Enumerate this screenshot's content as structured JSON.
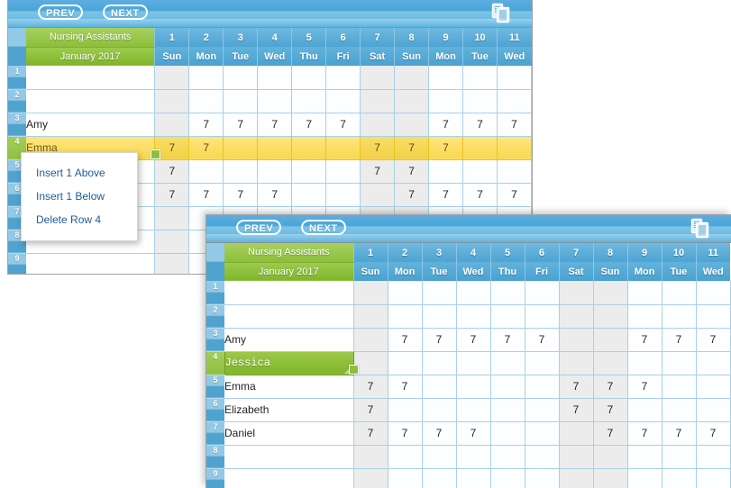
{
  "toolbar": {
    "prev_label": "PREV",
    "next_label": "NEXT",
    "copy_icon": "copy-documents-icon"
  },
  "header": {
    "group_title": "Nursing Assistants",
    "period": "January 2017"
  },
  "columns": [
    {
      "num": "1",
      "day": "Sun",
      "weekend": true
    },
    {
      "num": "2",
      "day": "Mon",
      "weekend": false
    },
    {
      "num": "3",
      "day": "Tue",
      "weekend": false
    },
    {
      "num": "4",
      "day": "Wed",
      "weekend": false
    },
    {
      "num": "5",
      "day": "Thu",
      "weekend": false
    },
    {
      "num": "6",
      "day": "Fri",
      "weekend": false
    },
    {
      "num": "7",
      "day": "Sat",
      "weekend": true
    },
    {
      "num": "8",
      "day": "Sun",
      "weekend": true
    },
    {
      "num": "9",
      "day": "Mon",
      "weekend": false
    },
    {
      "num": "10",
      "day": "Tue",
      "weekend": false
    },
    {
      "num": "11",
      "day": "Wed",
      "weekend": false
    }
  ],
  "shift_value": "7",
  "row_numbers": [
    "1",
    "2",
    "3",
    "4",
    "5",
    "6",
    "7",
    "8",
    "9"
  ],
  "table_one": {
    "rows": [
      {
        "num": "1",
        "name": "",
        "values": [
          "",
          "",
          "",
          "",
          "",
          "",
          "",
          "",
          "",
          "",
          ""
        ],
        "state": "normal"
      },
      {
        "num": "2",
        "name": "",
        "values": [
          "",
          "",
          "",
          "",
          "",
          "",
          "",
          "",
          "",
          "",
          ""
        ],
        "state": "normal"
      },
      {
        "num": "3",
        "name": "Amy",
        "values": [
          "",
          "7",
          "7",
          "7",
          "7",
          "7",
          "",
          "",
          "7",
          "7",
          "7"
        ],
        "state": "normal"
      },
      {
        "num": "4",
        "name": "Emma",
        "values": [
          "7",
          "7",
          "",
          "",
          "",
          "",
          "7",
          "7",
          "7",
          "",
          ""
        ],
        "state": "highlighted"
      },
      {
        "num": "5",
        "name": "",
        "values": [
          "7",
          "",
          "",
          "",
          "",
          "",
          "7",
          "7",
          "",
          "",
          ""
        ],
        "state": "normal"
      },
      {
        "num": "6",
        "name": "",
        "values": [
          "7",
          "7",
          "7",
          "7",
          "",
          "",
          "",
          "7",
          "7",
          "7",
          "7"
        ],
        "state": "normal"
      },
      {
        "num": "7",
        "name": "",
        "values": [
          "",
          "",
          "",
          "",
          "",
          "",
          "",
          "",
          "",
          "",
          ""
        ],
        "state": "normal"
      },
      {
        "num": "8",
        "name": "",
        "values": [
          "",
          "",
          "",
          "",
          "",
          "",
          "",
          "",
          "",
          "",
          ""
        ],
        "state": "normal"
      },
      {
        "num": "9",
        "name": "",
        "values": [
          "",
          "",
          "",
          "",
          "",
          "",
          "",
          "",
          "",
          "",
          ""
        ],
        "state": "normal"
      }
    ]
  },
  "table_two": {
    "rows": [
      {
        "num": "1",
        "name": "",
        "values": [
          "",
          "",
          "",
          "",
          "",
          "",
          "",
          "",
          "",
          "",
          ""
        ],
        "state": "normal"
      },
      {
        "num": "2",
        "name": "",
        "values": [
          "",
          "",
          "",
          "",
          "",
          "",
          "",
          "",
          "",
          "",
          ""
        ],
        "state": "normal"
      },
      {
        "num": "3",
        "name": "Amy",
        "values": [
          "",
          "7",
          "7",
          "7",
          "7",
          "7",
          "",
          "",
          "7",
          "7",
          "7"
        ],
        "state": "normal"
      },
      {
        "num": "4",
        "name": "Jessica",
        "values": [
          "",
          "",
          "",
          "",
          "",
          "",
          "",
          "",
          "",
          "",
          ""
        ],
        "state": "editing"
      },
      {
        "num": "5",
        "name": "Emma",
        "values": [
          "7",
          "7",
          "",
          "",
          "",
          "",
          "7",
          "7",
          "7",
          "",
          ""
        ],
        "state": "normal"
      },
      {
        "num": "6",
        "name": "Elizabeth",
        "values": [
          "7",
          "",
          "",
          "",
          "",
          "",
          "7",
          "7",
          "",
          "",
          ""
        ],
        "state": "normal"
      },
      {
        "num": "7",
        "name": "Daniel",
        "values": [
          "7",
          "7",
          "7",
          "7",
          "",
          "",
          "",
          "7",
          "7",
          "7",
          "7"
        ],
        "state": "normal"
      },
      {
        "num": "8",
        "name": "",
        "values": [
          "",
          "",
          "",
          "",
          "",
          "",
          "",
          "",
          "",
          "",
          ""
        ],
        "state": "normal"
      },
      {
        "num": "9",
        "name": "",
        "values": [
          "",
          "",
          "",
          "",
          "",
          "",
          "",
          "",
          "",
          "",
          ""
        ],
        "state": "normal"
      }
    ]
  },
  "context_menu": {
    "items": [
      {
        "label": "Insert 1 Above",
        "name": "insert-above"
      },
      {
        "label": "Insert 1 Below",
        "name": "insert-below"
      },
      {
        "label": "Delete Row 4",
        "name": "delete-row"
      }
    ]
  },
  "colors": {
    "header_blue": "#4da4d2",
    "group_green": "#8cbf3b",
    "highlight_yellow": "#f7d84e",
    "weekend_gray": "#ececec",
    "menu_link": "#1f5c9a"
  }
}
